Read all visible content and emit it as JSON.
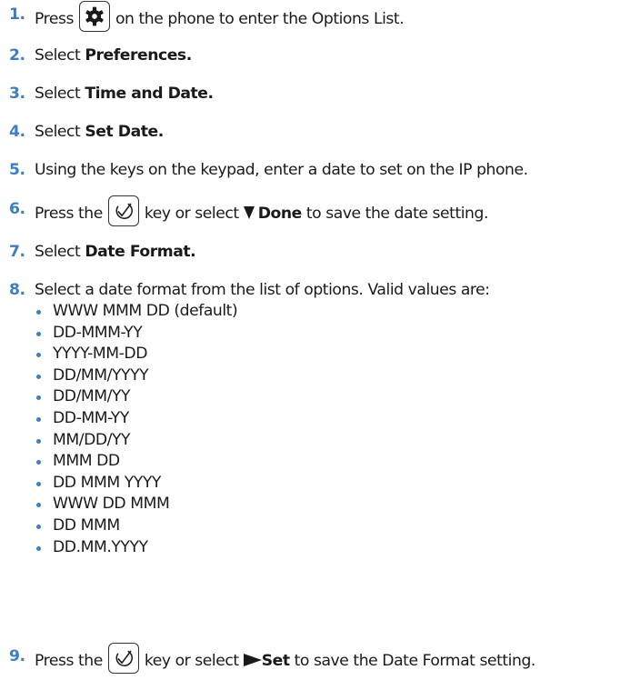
{
  "steps": [
    {
      "num": "1.",
      "parts": {
        "a": "Press",
        "b": "on the phone to enter the Options List."
      }
    },
    {
      "num": "2.",
      "parts": {
        "a": "Select ",
        "b": "Preferences."
      }
    },
    {
      "num": "3.",
      "parts": {
        "a": "Select ",
        "b": "Time and Date."
      }
    },
    {
      "num": "4.",
      "parts": {
        "a": "Select ",
        "b": "Set Date."
      }
    },
    {
      "num": "5.",
      "parts": {
        "a": "Using the keys on the keypad, enter a date to set on the IP phone."
      }
    },
    {
      "num": "6.",
      "parts": {
        "a": "Press the",
        "b": "key or select ",
        "c": "Done",
        "d": " to save the date setting."
      }
    },
    {
      "num": "7.",
      "parts": {
        "a": "Select ",
        "b": "Date Format."
      }
    },
    {
      "num": "8.",
      "parts": {
        "a": "Select a date format from the list of options. Valid values are:"
      }
    },
    {
      "num": "9.",
      "parts": {
        "a": "Press the",
        "b": "key or select ",
        "c": "Set",
        "d": " to save the Date Format setting."
      }
    }
  ],
  "date_formats": [
    "WWW MMM DD (default)",
    "DD-MMM-YY",
    "YYYY-MM-DD",
    "DD/MM/YYYY",
    "DD/MM/YY",
    "DD-MM-YY",
    "MM/DD/YY",
    "MMM DD",
    "DD MMM YYYY",
    "WWW DD MMM",
    "DD MMM",
    "DD.MM.YYYY"
  ],
  "icons": {
    "options_key": "gear-icon",
    "done_key": "checkmark-icon",
    "down_softkey": "triangle-down-icon",
    "right_softkey": "triangle-right-icon"
  },
  "colors": {
    "accent": "#3a7fc3",
    "text": "#1a1a1a"
  }
}
